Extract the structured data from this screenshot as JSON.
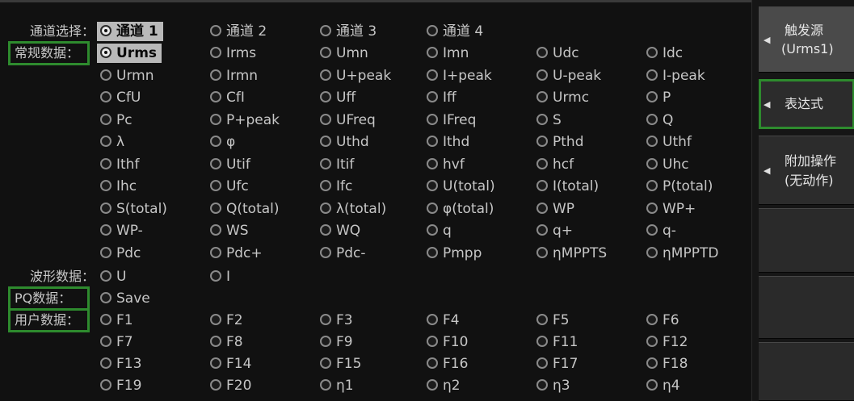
{
  "channel_select": {
    "label": "通道选择：",
    "options": [
      "通道 1",
      "通道 2",
      "通道 3",
      "通道 4"
    ],
    "selected_index": 0
  },
  "normal_data": {
    "label": "常规数据：",
    "selected": "Urms",
    "rows": [
      [
        "Urms",
        "Irms",
        "Umn",
        "Imn",
        "Udc",
        "Idc"
      ],
      [
        "Urmn",
        "Irmn",
        "U+peak",
        "I+peak",
        "U-peak",
        "I-peak"
      ],
      [
        "CfU",
        "CfI",
        "Uff",
        "Iff",
        "Urmc",
        "P"
      ],
      [
        "Pc",
        "P+peak",
        "UFreq",
        "IFreq",
        "S",
        "Q"
      ],
      [
        "λ",
        "φ",
        "Uthd",
        "Ithd",
        "Pthd",
        "Uthf"
      ],
      [
        "Ithf",
        "Utif",
        "Itif",
        "hvf",
        "hcf",
        "Uhc"
      ],
      [
        "Ihc",
        "Ufc",
        "Ifc",
        "U(total)",
        "I(total)",
        "P(total)"
      ],
      [
        "S(total)",
        "Q(total)",
        "λ(total)",
        "φ(total)",
        "WP",
        "WP+"
      ],
      [
        "WP-",
        "WS",
        "WQ",
        "q",
        "q+",
        "q-"
      ],
      [
        "Pdc",
        "Pdc+",
        "Pdc-",
        "Pmpp",
        "ηMPPTS",
        "ηMPPTD"
      ]
    ]
  },
  "wave_data": {
    "label": "波形数据：",
    "options": [
      "U",
      "I"
    ]
  },
  "pq_data": {
    "label": "PQ数据：",
    "options": [
      "Save"
    ]
  },
  "user_data": {
    "label": "用户数据：",
    "rows": [
      [
        "F1",
        "F2",
        "F3",
        "F4",
        "F5",
        "F6"
      ],
      [
        "F7",
        "F8",
        "F9",
        "F10",
        "F11",
        "F12"
      ],
      [
        "F13",
        "F14",
        "F15",
        "F16",
        "F17",
        "F18"
      ],
      [
        "F19",
        "F20",
        "η1",
        "η2",
        "η3",
        "η4"
      ]
    ]
  },
  "sidebar": {
    "trigger_source": {
      "line1": "触发源",
      "line2": "(Urms1)"
    },
    "expression": {
      "label": "表达式"
    },
    "extra_op": {
      "line1": "附加操作",
      "line2": "(无动作)"
    }
  },
  "colors": {
    "highlight_box": "#2e8b2e",
    "selected_bg": "#b9b9b9"
  }
}
